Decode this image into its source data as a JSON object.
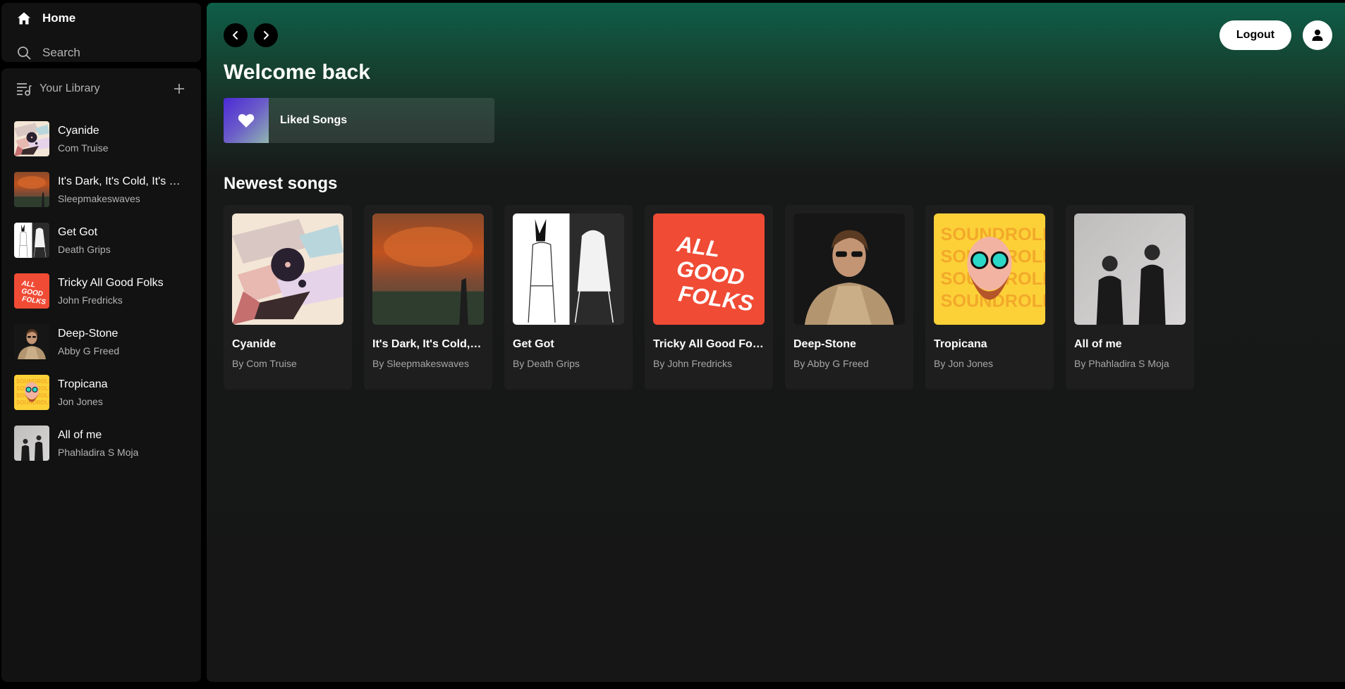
{
  "nav": {
    "home_label": "Home",
    "search_label": "Search"
  },
  "library": {
    "title": "Your Library",
    "items": [
      {
        "name": "Cyanide",
        "artist": "Com Truise",
        "cover": "cyanide"
      },
      {
        "name": "It's Dark, It's Cold, It's W...",
        "artist": "Sleepmakeswaves",
        "cover": "dark"
      },
      {
        "name": "Get Got",
        "artist": "Death Grips",
        "cover": "getgot"
      },
      {
        "name": "Tricky All Good Folks",
        "artist": "John Fredricks",
        "cover": "folks"
      },
      {
        "name": "Deep-Stone",
        "artist": "Abby G Freed",
        "cover": "deepstone"
      },
      {
        "name": "Tropicana",
        "artist": "Jon Jones",
        "cover": "tropicana"
      },
      {
        "name": "All of me",
        "artist": "Phahladira S Moja",
        "cover": "allofme"
      }
    ]
  },
  "header": {
    "logout_label": "Logout"
  },
  "main": {
    "welcome": "Welcome back",
    "liked_songs_label": "Liked Songs",
    "newest_title": "Newest songs",
    "cards": [
      {
        "title": "Cyanide",
        "by": "By Com Truise",
        "cover": "cyanide"
      },
      {
        "title": "It's Dark, It's Cold, It...",
        "by": "By Sleepmakeswaves",
        "cover": "dark"
      },
      {
        "title": "Get Got",
        "by": "By Death Grips",
        "cover": "getgot"
      },
      {
        "title": "Tricky All Good Folks",
        "by": "By John Fredricks",
        "cover": "folks"
      },
      {
        "title": "Deep-Stone",
        "by": "By Abby G Freed",
        "cover": "deepstone"
      },
      {
        "title": "Tropicana",
        "by": "By Jon Jones",
        "cover": "tropicana"
      },
      {
        "title": "All of me",
        "by": "By Phahladira S Moja",
        "cover": "allofme"
      }
    ]
  },
  "art_text": {
    "folks": [
      "ALL",
      "GOOD",
      "FOLKS"
    ],
    "tropicana": "SOUNDROLL"
  },
  "colors": {
    "accent_green": "#0e5e48",
    "panel": "#121212",
    "card": "#1e1e1e"
  }
}
